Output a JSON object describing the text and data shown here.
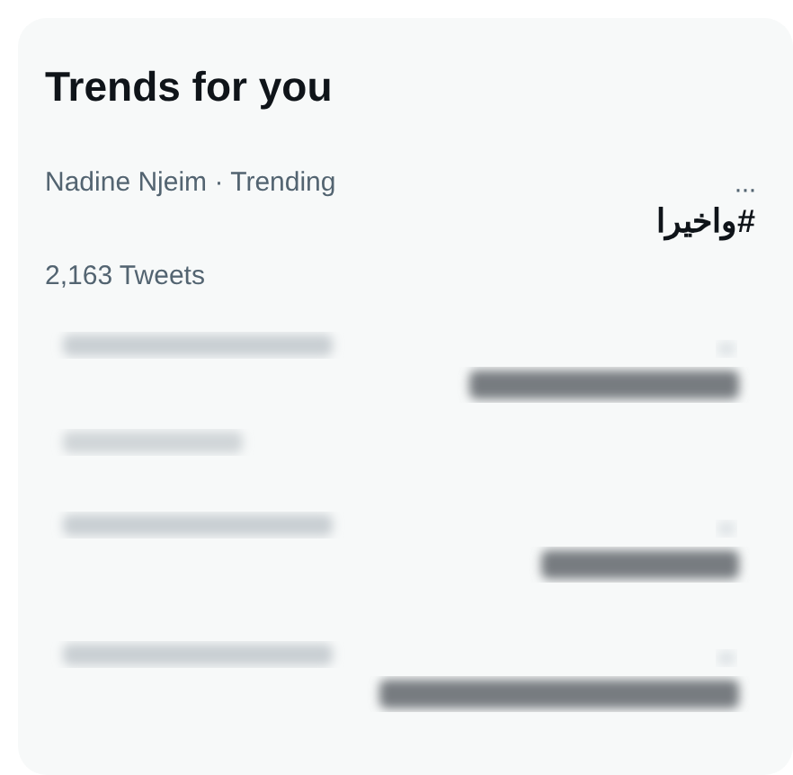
{
  "panel": {
    "title": "Trends for you"
  },
  "trends": [
    {
      "context": "Nadine Njeim · Trending",
      "more": "···",
      "name": "#واخيرا",
      "count": "2,163 Tweets"
    }
  ],
  "blurred_trends": [
    {
      "with_count": true
    },
    {
      "with_count": false
    },
    {
      "with_count": false
    }
  ]
}
